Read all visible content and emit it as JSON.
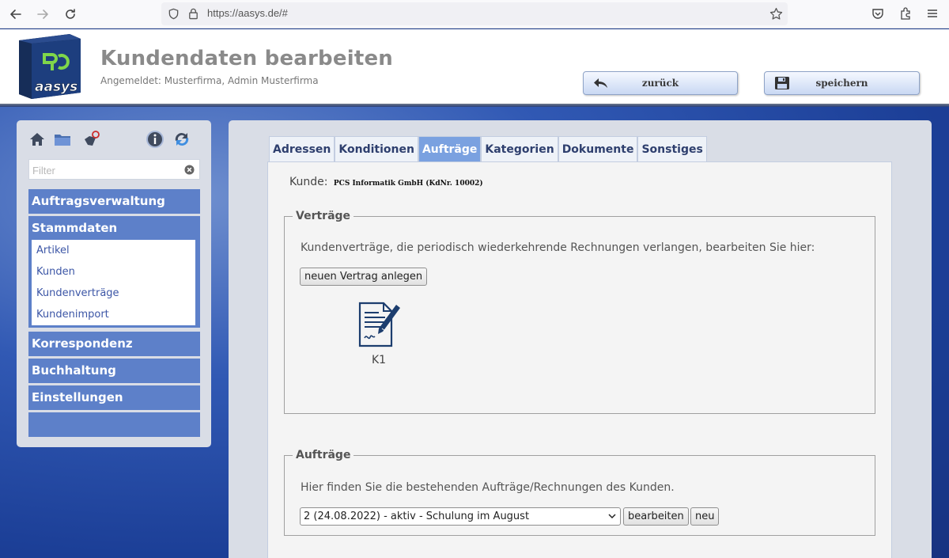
{
  "browser": {
    "url": "https://aasys.de/#"
  },
  "header": {
    "title": "Kundendaten bearbeiten",
    "login_info": "Angemeldet: Musterfirma, Admin Musterfirma",
    "back_label": "zurück",
    "save_label": "speichern",
    "logo_text": "aasys"
  },
  "sidebar": {
    "filter_placeholder": "Filter",
    "sections": {
      "auftragsverwaltung": "Auftragsverwaltung",
      "stammdaten": "Stammdaten",
      "korrespondenz": "Korrespondenz",
      "buchhaltung": "Buchhaltung",
      "einstellungen": "Einstellungen"
    },
    "stammdaten_items": [
      "Artikel",
      "Kunden",
      "Kundenverträge",
      "Kundenimport"
    ]
  },
  "tabs": [
    "Adressen",
    "Konditionen",
    "Aufträge",
    "Kategorien",
    "Dokumente",
    "Sonstiges"
  ],
  "active_tab": "Aufträge",
  "content": {
    "kunde_label": "Kunde:",
    "kunde_name": "PCS Informatik GmbH (KdNr. 10002)",
    "vertraege": {
      "legend": "Verträge",
      "description": "Kundenverträge, die periodisch wiederkehrende Rechnungen verlangen, bearbeiten Sie hier:",
      "new_button": "neuen Vertrag anlegen",
      "contract_label": "K1"
    },
    "auftraege": {
      "legend": "Aufträge",
      "description": "Hier finden Sie die bestehenden Aufträge/Rechnungen des Kunden.",
      "selected_order": "2 (24.08.2022) - aktiv - Schulung im August",
      "edit_button": "bearbeiten",
      "new_button": "neu"
    }
  },
  "colors": {
    "accent": "#5d80c9",
    "active_tab": "#7aa1e0",
    "panel": "#d9dde6",
    "title": "#8a8a8a"
  }
}
